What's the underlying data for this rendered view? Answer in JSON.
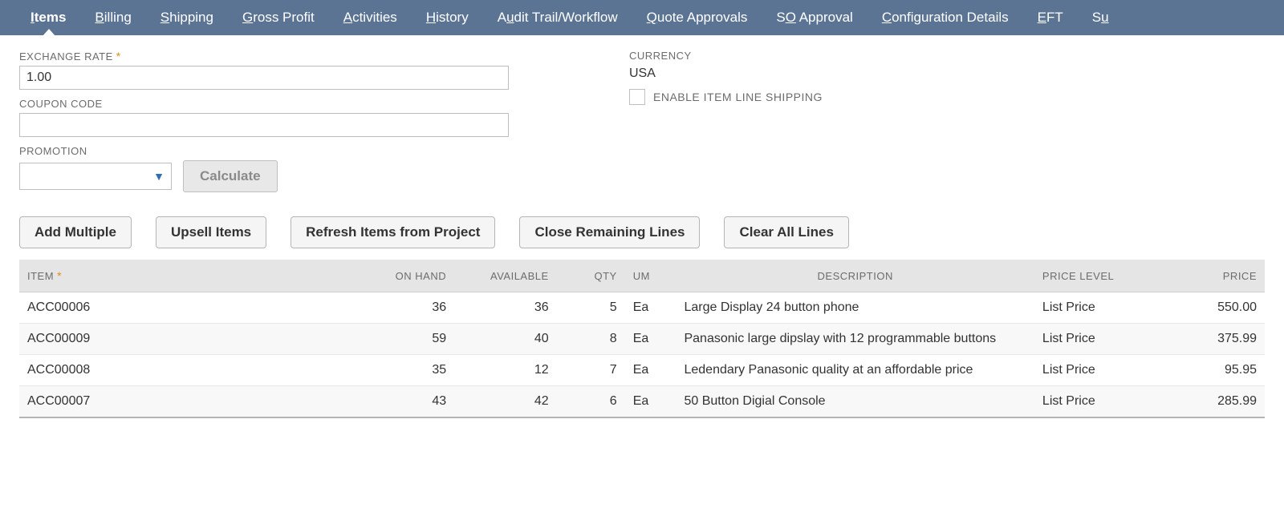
{
  "tabs": [
    {
      "pre": "",
      "u": "I",
      "post": "tems",
      "active": true
    },
    {
      "pre": "",
      "u": "B",
      "post": "illing"
    },
    {
      "pre": "",
      "u": "S",
      "post": "hipping"
    },
    {
      "pre": "",
      "u": "G",
      "post": "ross Profit"
    },
    {
      "pre": "",
      "u": "A",
      "post": "ctivities"
    },
    {
      "pre": "",
      "u": "H",
      "post": "istory"
    },
    {
      "pre": "A",
      "u": "u",
      "post": "dit Trail/Workflow"
    },
    {
      "pre": "",
      "u": "Q",
      "post": "uote Approvals"
    },
    {
      "pre": "S",
      "u": "O",
      "post": " Approval"
    },
    {
      "pre": "",
      "u": "C",
      "post": "onfiguration Details"
    },
    {
      "pre": "",
      "u": "E",
      "post": "FT"
    },
    {
      "pre": "S",
      "u": "u",
      "post": ""
    }
  ],
  "form": {
    "exchange_rate_label": "EXCHANGE RATE",
    "exchange_rate_value": "1.00",
    "coupon_code_label": "COUPON CODE",
    "coupon_code_value": "",
    "promotion_label": "PROMOTION",
    "promotion_value": "",
    "calculate_label": "Calculate",
    "currency_label": "CURRENCY",
    "currency_value": "USA",
    "enable_shipping_label": "ENABLE ITEM LINE SHIPPING"
  },
  "buttons": {
    "add_multiple": "Add Multiple",
    "upsell_items": "Upsell Items",
    "refresh_project": "Refresh Items from Project",
    "close_remaining": "Close Remaining Lines",
    "clear_all": "Clear All Lines"
  },
  "table": {
    "headers": {
      "item": "ITEM",
      "on_hand": "ON HAND",
      "available": "AVAILABLE",
      "qty": "QTY",
      "um": "UM",
      "description": "DESCRIPTION",
      "price_level": "PRICE LEVEL",
      "price": "PRICE"
    },
    "rows": [
      {
        "item": "ACC00006",
        "on_hand": "36",
        "available": "36",
        "qty": "5",
        "um": "Ea",
        "description": "Large Display 24 button phone",
        "price_level": "List Price",
        "price": "550.00"
      },
      {
        "item": "ACC00009",
        "on_hand": "59",
        "available": "40",
        "qty": "8",
        "um": "Ea",
        "description": "Panasonic large dipslay with 12 programmable buttons",
        "price_level": "List Price",
        "price": "375.99"
      },
      {
        "item": "ACC00008",
        "on_hand": "35",
        "available": "12",
        "qty": "7",
        "um": "Ea",
        "description": "Ledendary Panasonic quality at an affordable price",
        "price_level": "List Price",
        "price": "95.95"
      },
      {
        "item": "ACC00007",
        "on_hand": "43",
        "available": "42",
        "qty": "6",
        "um": "Ea",
        "description": "50 Button Digial Console",
        "price_level": "List Price",
        "price": "285.99"
      }
    ]
  }
}
